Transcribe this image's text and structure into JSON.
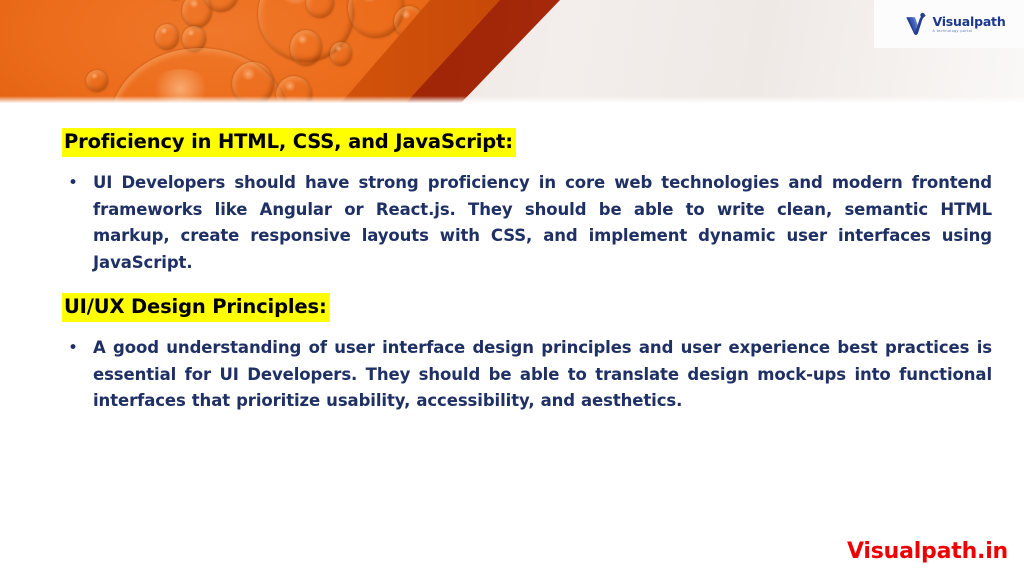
{
  "slide": {
    "banner": {
      "image_name": "orange-bubbles-photo",
      "colors": {
        "orange": "#ec6d1c",
        "maroon": "#9c2205",
        "light": "#efe9e6"
      }
    },
    "logo": {
      "word": "Visualpath",
      "tagline": "A technology portal",
      "mark_name": "visualpath-v-mark",
      "color": "#1b3a8f"
    },
    "sections": [
      {
        "heading": "Proficiency in HTML, CSS, and JavaScript:",
        "heading_highlight": "#ffff00",
        "bullets": [
          {
            "marker": "•",
            "text": "UI Developers should have strong proficiency in core web technologies and modern frontend frameworks like Angular or React.js. They should be able to write clean, semantic HTML markup, create responsive layouts with CSS, and implement dynamic user interfaces using JavaScript."
          }
        ]
      },
      {
        "heading": "UI/UX Design Principles:",
        "heading_highlight": "#ffff00",
        "bullets": [
          {
            "marker": "•",
            "text": "A good understanding of user interface design principles and user experience best practices is essential for UI Developers. They should be able to translate design mock-ups into functional interfaces that prioritize usability, accessibility, and aesthetics."
          }
        ]
      }
    ],
    "footer": {
      "text": "Visualpath.in",
      "color": "#ee0000"
    },
    "body_text_color": "#1f3064"
  }
}
